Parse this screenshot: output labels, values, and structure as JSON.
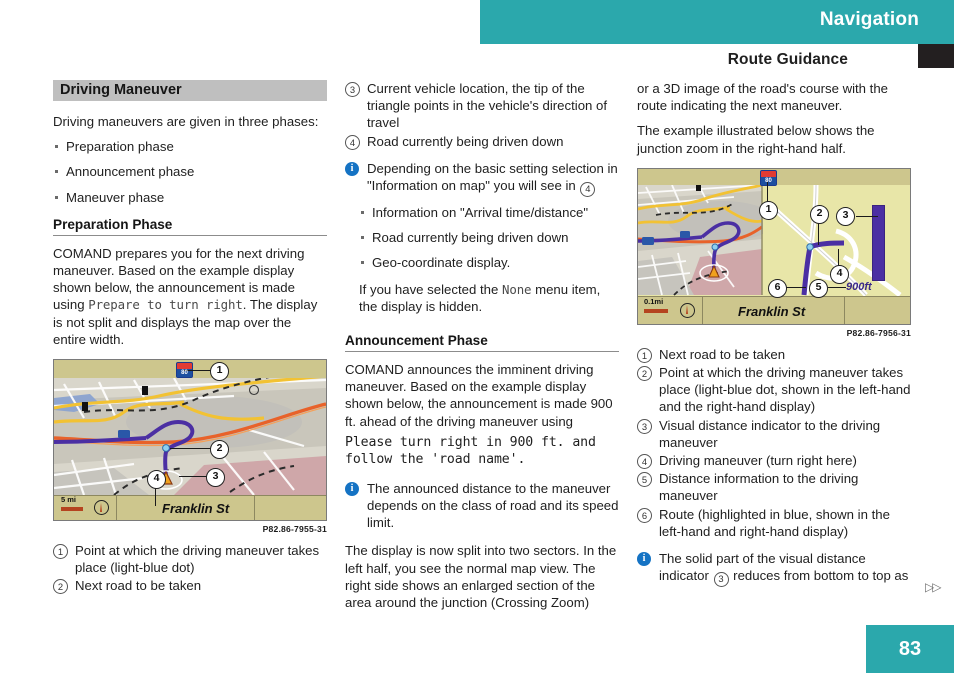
{
  "header": {
    "chapter": "Navigation",
    "section": "Route Guidance",
    "teal_color": "#2ba8ac",
    "tab_color": "#231f20"
  },
  "footer": {
    "page_number": "83",
    "continuation_marker": "▷▷"
  },
  "col1": {
    "section_bar": "Driving Maneuver",
    "intro": "Driving maneuvers are given in three phases:",
    "phases": [
      "Preparation phase",
      "Announcement phase",
      "Maneuver phase"
    ],
    "sub_heading": "Preparation Phase",
    "para_1a": "COMAND prepares you for the next driving maneuver. Based on the example display shown below, the announcement is made using ",
    "para_1_mono": "Prepare to turn right",
    "para_1b": ". The display is not split and displays the map over the entire width.",
    "figure": {
      "caption": "P82.86-7955-31",
      "street_name": "Franklin St",
      "scale_label": "5 mi",
      "route_shield": "80",
      "markers": [
        "1",
        "2",
        "3",
        "4"
      ]
    },
    "legend": [
      {
        "num": "1",
        "text": "Point at which the driving maneuver takes place (light-blue dot)"
      },
      {
        "num": "2",
        "text": "Next road to be taken"
      }
    ]
  },
  "col2": {
    "legend_top": [
      {
        "num": "3",
        "text": "Current vehicle location, the tip of the triangle points in the vehicle's direction of travel"
      },
      {
        "num": "4",
        "text": "Road currently being driven down"
      }
    ],
    "note_1a": "Depending on the basic setting selection in \"Information on map\" you will see in ",
    "note_1_ref": "4",
    "note_1_items": [
      "Information on \"Arrival time/distance\"",
      "Road currently being driven down",
      "Geo-coordinate display."
    ],
    "note_1_tail_a": "If you have selected the ",
    "note_1_tail_mono": "None",
    "note_1_tail_b": " menu item, the display is hidden.",
    "sub_heading": "Announcement Phase",
    "para_2a": "COMAND announces the imminent driving maneuver. Based on the example display shown below, the announcement is made 900 ft. ahead of the driving maneuver using ",
    "para_2_mono": "Please turn right in 900 ft. and follow the 'road name'.",
    "note_2": "The announced distance to the maneuver depends on the class of road and its speed limit.",
    "para_3": "The display is now split into two sectors. In the left half, you see the normal map view. The right side shows an enlarged section of the area around the junction (Crossing Zoom)"
  },
  "col3": {
    "para_1": "or a 3D image of the road's course with the route indicating the next maneuver.",
    "para_2": "The example illustrated below shows the junction zoom in the right-hand half.",
    "figure": {
      "caption": "P82.86-7956-31",
      "street_name": "Franklin St",
      "scale_label": "0.1mi",
      "route_shield": "80",
      "distance_label": "900ft",
      "markers": [
        "1",
        "2",
        "3",
        "4",
        "5",
        "6"
      ]
    },
    "legend": [
      {
        "num": "1",
        "text": "Next road to be taken"
      },
      {
        "num": "2",
        "text": "Point at which the driving maneuver takes place (light-blue dot, shown in the left-hand and the right-hand display)"
      },
      {
        "num": "3",
        "text": "Visual distance indicator to the driving maneuver"
      },
      {
        "num": "4",
        "text": "Driving maneuver (turn right here)"
      },
      {
        "num": "5",
        "text": "Distance information to the driving maneuver"
      },
      {
        "num": "6",
        "text": "Route (highlighted in blue, shown in the left-hand and right-hand display)"
      }
    ],
    "note_a": "The solid part of the visual distance indicator ",
    "note_ref": "3",
    "note_b": " reduces from bottom to top as"
  }
}
